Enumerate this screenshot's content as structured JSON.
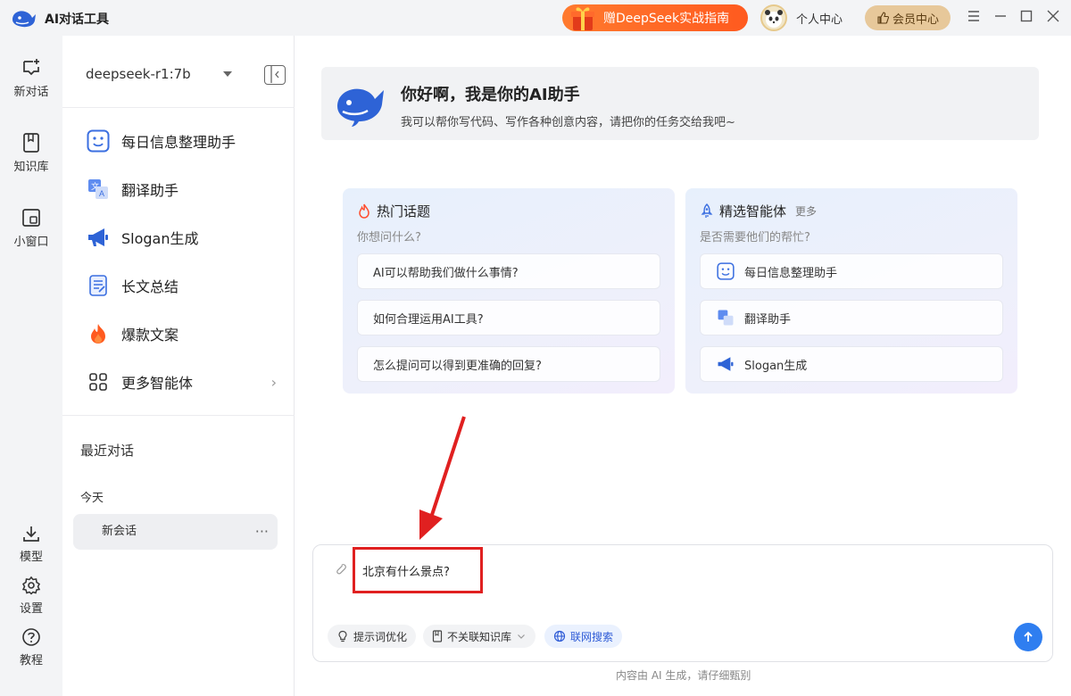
{
  "app": {
    "title": "AI对话工具"
  },
  "titlebar": {
    "promo_label": "赠DeepSeek实战指南",
    "profile_label": "个人中心",
    "vip_label": "会员中心"
  },
  "rail": {
    "new_chat": "新对话",
    "knowledge": "知识库",
    "mini_window": "小窗口",
    "model": "模型",
    "settings": "设置",
    "tutorial": "教程"
  },
  "sidebar": {
    "model_selected": "deepseek-r1:7b",
    "agents": [
      {
        "label": "每日信息整理助手",
        "icon": "smile-face-icon"
      },
      {
        "label": "翻译助手",
        "icon": "translate-icon"
      },
      {
        "label": "Slogan生成",
        "icon": "megaphone-icon"
      },
      {
        "label": "长文总结",
        "icon": "document-icon"
      },
      {
        "label": "爆款文案",
        "icon": "fire-icon"
      },
      {
        "label": "更多智能体",
        "icon": "grid-icon"
      }
    ],
    "recent_title": "最近对话",
    "today_label": "今天",
    "session_label": "新会话"
  },
  "welcome": {
    "title": "你好啊，我是你的AI助手",
    "subtitle": "我可以帮你写代码、写作各种创意内容，请把你的任务交给我吧~"
  },
  "hot_topics": {
    "title": "热门话题",
    "subtitle": "你想问什么?",
    "items": [
      "AI可以帮助我们做什么事情?",
      "如何合理运用AI工具?",
      "怎么提问可以得到更准确的回复?"
    ]
  },
  "featured_agents": {
    "title": "精选智能体",
    "more": "更多",
    "subtitle": "是否需要他们的帮忙?",
    "items": [
      "每日信息整理助手",
      "翻译助手",
      "Slogan生成"
    ]
  },
  "composer": {
    "input_value": "北京有什么景点?",
    "prompt_optimize": "提示词优化",
    "knowledge_toggle": "不关联知识库",
    "web_search": "联网搜索"
  },
  "footnote": "内容由 AI 生成，请仔细甄别",
  "colors": {
    "accent": "#2f7ef0",
    "promo": "#ff5a1f",
    "highlight": "#e02020",
    "vip": "#e7c89a"
  }
}
